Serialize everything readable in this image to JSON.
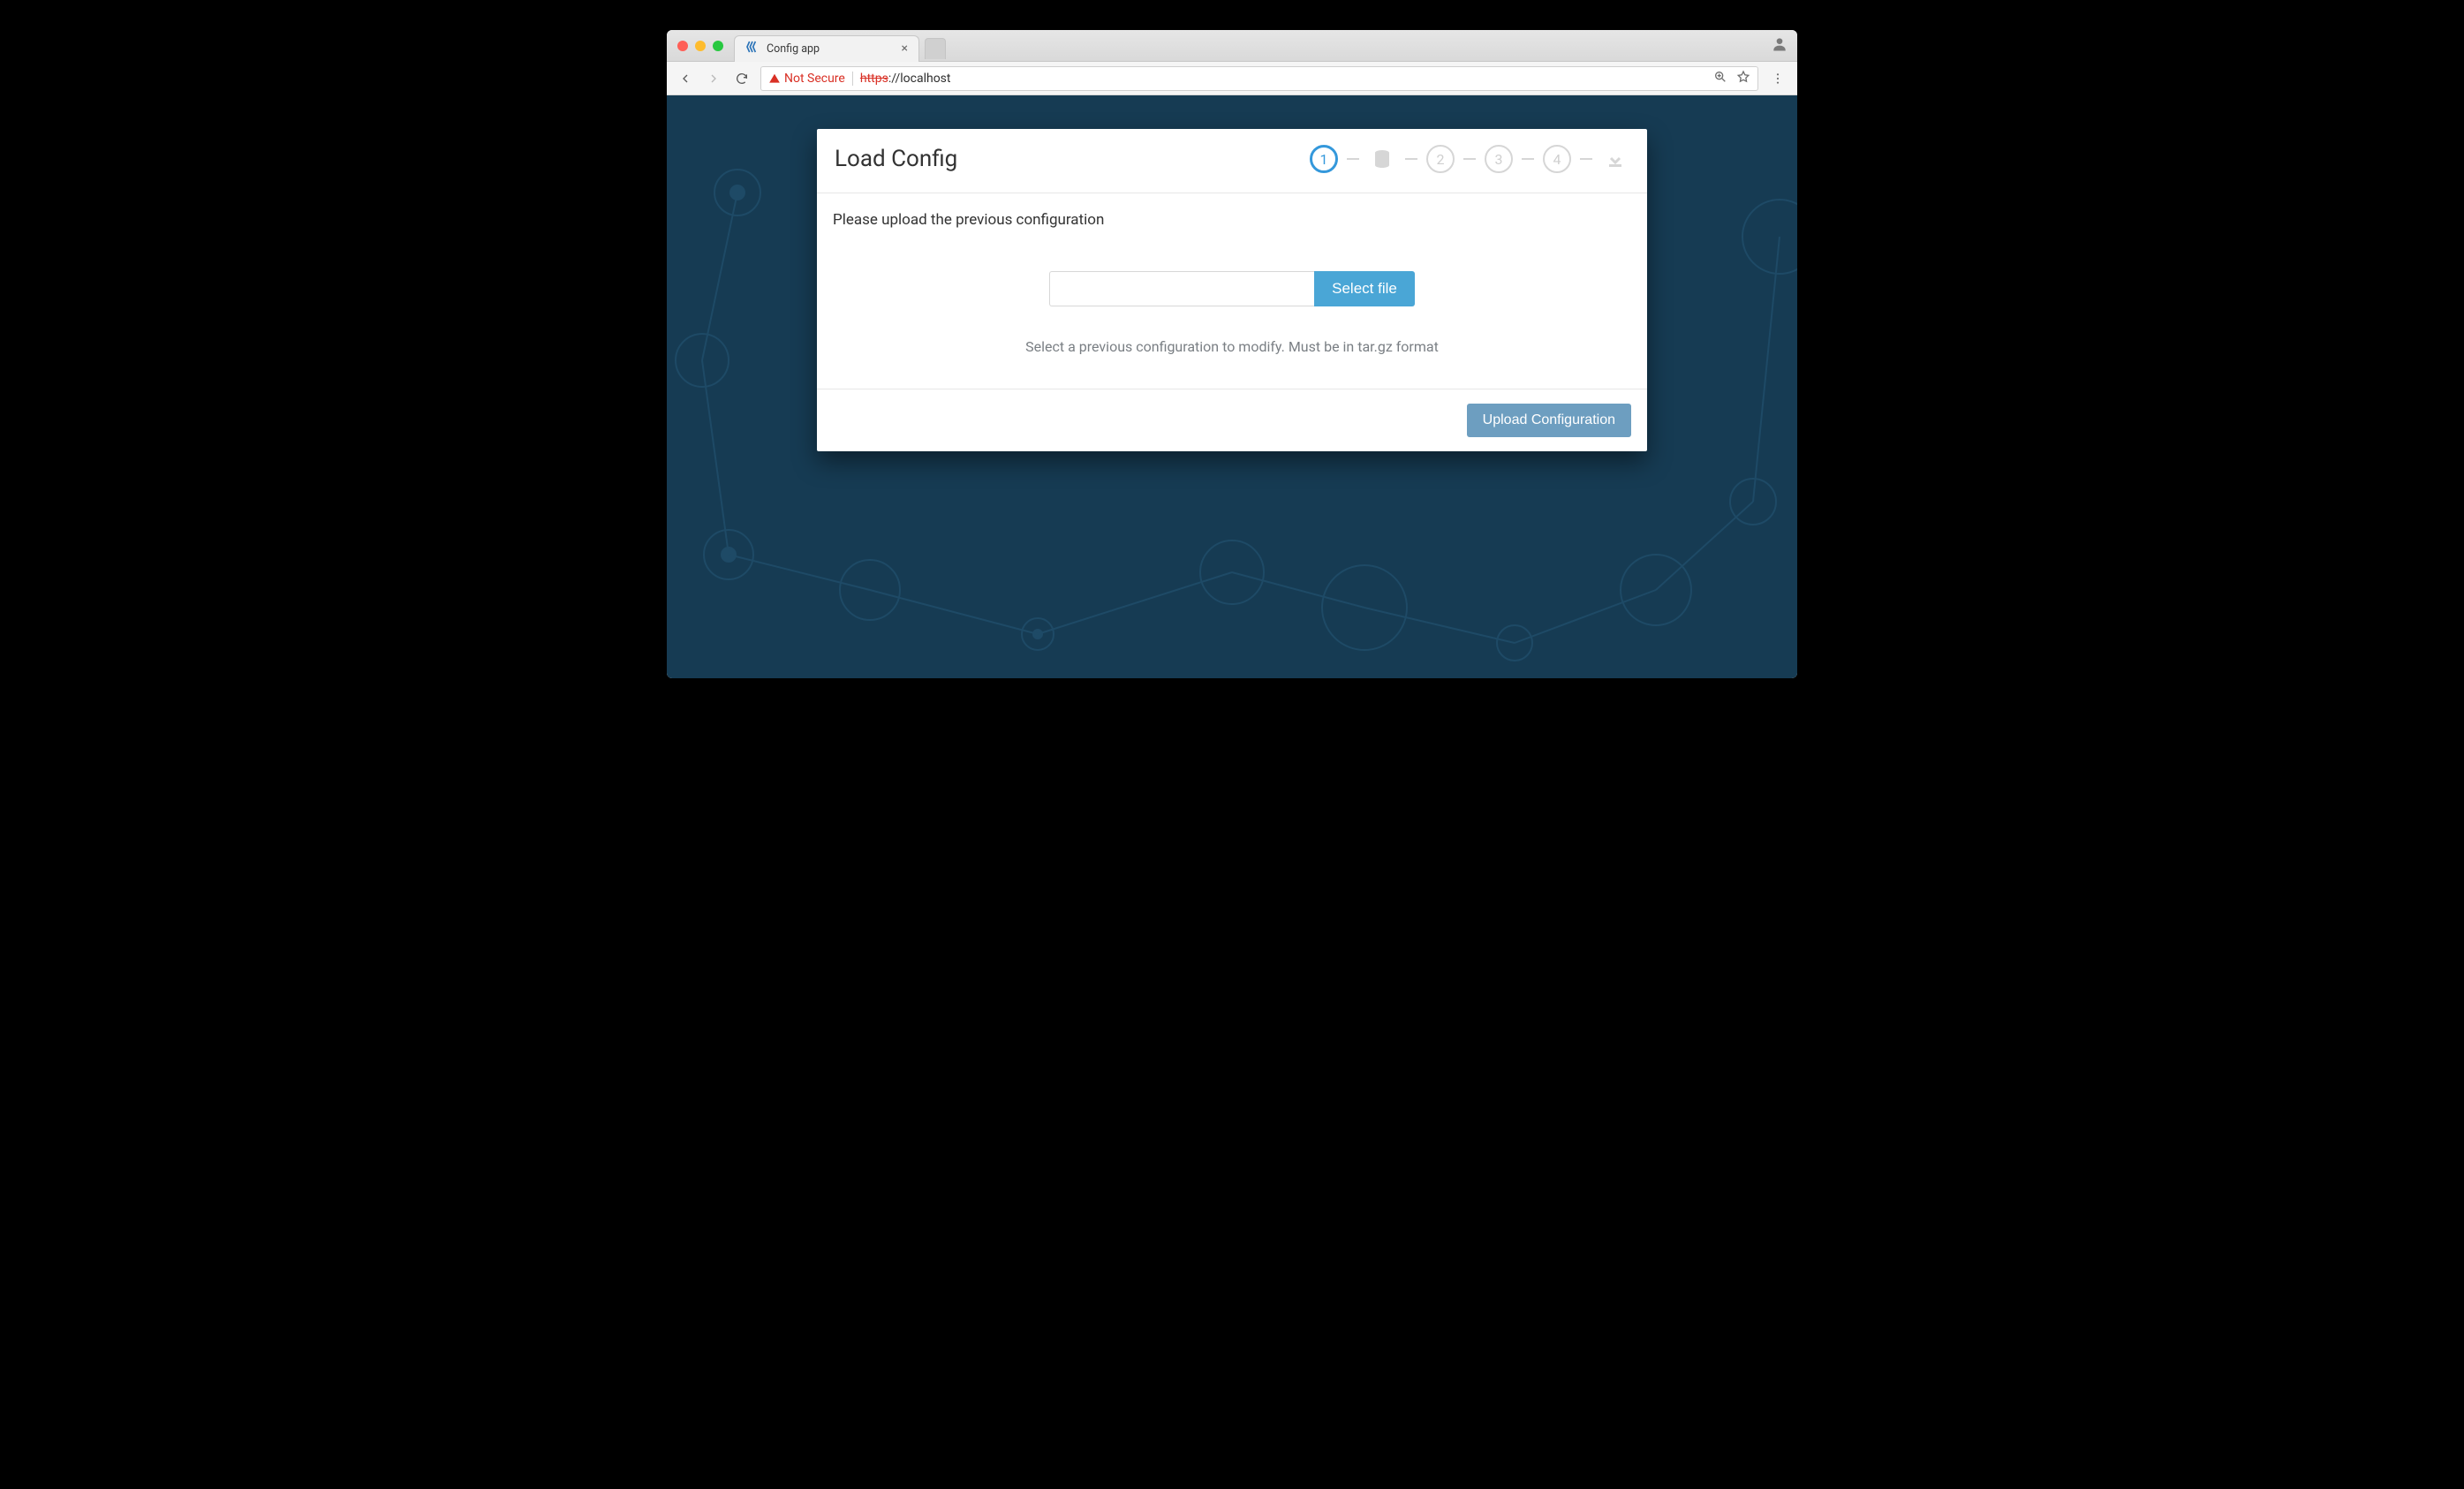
{
  "browser": {
    "tab_title": "Config app",
    "not_secure_label": "Not Secure",
    "url_https": "https",
    "url_rest": "://localhost"
  },
  "page": {
    "title": "Load Config",
    "instruction": "Please upload the previous configuration",
    "select_file_label": "Select file",
    "hint": "Select a previous configuration to modify. Must be in tar.gz format",
    "upload_button_label": "Upload Configuration",
    "steps": {
      "s1": "1",
      "s2": "2",
      "s3": "3",
      "s4": "4"
    }
  },
  "colors": {
    "accent": "#3498db",
    "bg": "#163b53"
  }
}
